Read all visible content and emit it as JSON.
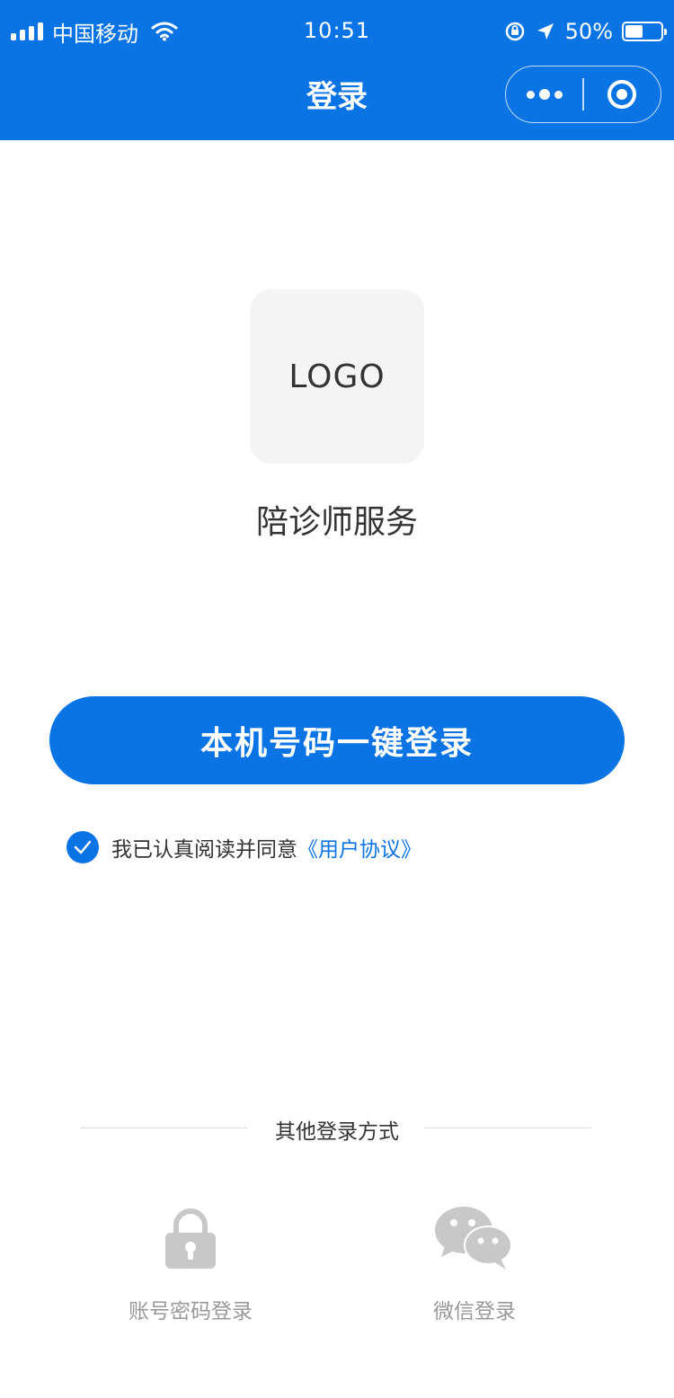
{
  "status_bar": {
    "carrier": "中国移动",
    "time": "10:51",
    "battery": "50%",
    "battery_level": 0.5
  },
  "nav": {
    "title": "登录"
  },
  "logo": {
    "text": "LOGO"
  },
  "app_name": "陪诊师服务",
  "login_button": "本机号码一键登录",
  "agreement": {
    "checked": true,
    "text": "我已认真阅读并同意",
    "link": "《用户协议》"
  },
  "other_login": {
    "title": "其他登录方式",
    "methods": [
      {
        "label": "账号密码登录",
        "icon": "lock-icon"
      },
      {
        "label": "微信登录",
        "icon": "wechat-icon"
      }
    ]
  },
  "colors": {
    "brand": "#0b74e5",
    "icon_gray": "#c8c8c8",
    "muted_text": "#999999"
  }
}
